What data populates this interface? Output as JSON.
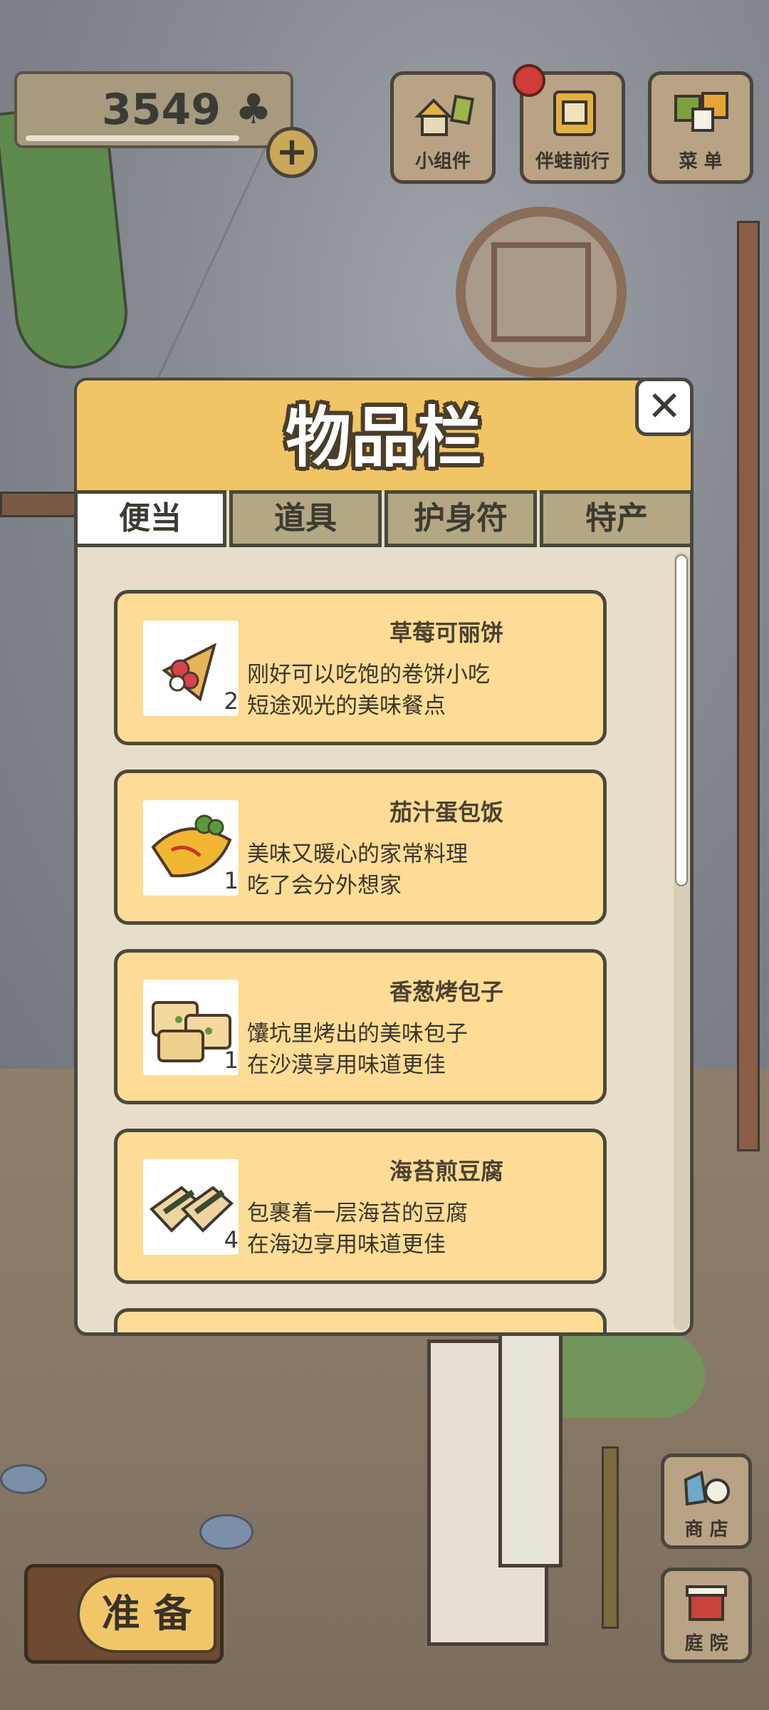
{
  "hud": {
    "clover_count": "3549",
    "clover_symbol": "♣",
    "plus_symbol": "+"
  },
  "top_buttons": [
    {
      "label": "小组件",
      "icon": "widget-icon"
    },
    {
      "label": "伴蛙前行",
      "icon": "travel-companion-icon",
      "notification": true
    },
    {
      "label": "菜 单",
      "icon": "menu-icon"
    }
  ],
  "dialog": {
    "title": "物品栏",
    "close_symbol": "✕",
    "tabs": [
      {
        "label": "便当",
        "active": true
      },
      {
        "label": "道具",
        "active": false
      },
      {
        "label": "护身符",
        "active": false
      },
      {
        "label": "特产",
        "active": false
      }
    ],
    "items": [
      {
        "name": "草莓可丽饼",
        "desc1": "刚好可以吃饱的卷饼小吃",
        "desc2": "短途观光的美味餐点",
        "qty": "2",
        "icon": "strawberry-crepe-icon"
      },
      {
        "name": "茄汁蛋包饭",
        "desc1": "美味又暖心的家常料理",
        "desc2": "吃了会分外想家",
        "qty": "1",
        "icon": "omurice-icon"
      },
      {
        "name": "香葱烤包子",
        "desc1": "馕坑里烤出的美味包子",
        "desc2": "在沙漠享用味道更佳",
        "qty": "1",
        "icon": "baked-bun-icon"
      },
      {
        "name": "海苔煎豆腐",
        "desc1": "包裹着一层海苔的豆腐",
        "desc2": "在海边享用味道更佳",
        "qty": "4",
        "icon": "seaweed-tofu-icon"
      }
    ]
  },
  "bottom": {
    "prepare_label": "准 备",
    "shop_label": "商 店",
    "garden_label": "庭 院"
  },
  "colors": {
    "dialog_header": "#f1c565",
    "card_bg": "#fedc95",
    "notification": "#d23b37"
  }
}
